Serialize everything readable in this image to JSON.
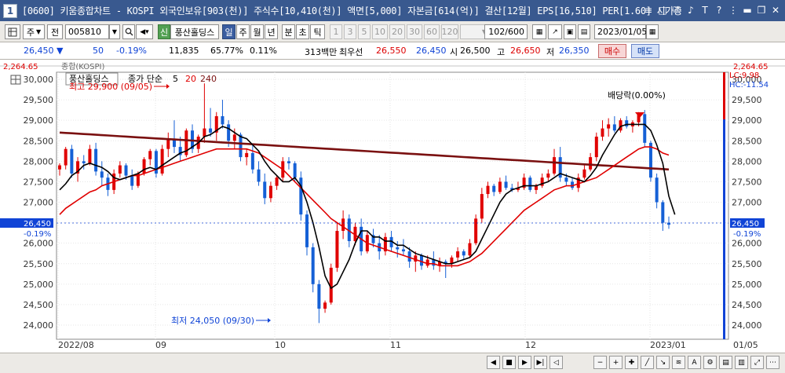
{
  "window": {
    "icon_label": "1",
    "title": "[0600] 키움종합차트 - KOSPI 외국인보유[903(천)] 주식수[10,410(천)] 액면[5,000] 자본금[614(억)] 결산[12월] EPS[16,510] PER[1.60] 시가총",
    "buttons": [
      "≡",
      "□",
      "⎚",
      "♪",
      "T",
      "?",
      "⋮",
      "▬",
      "❐",
      "✕"
    ]
  },
  "toolbar": {
    "chart_icon": "chart-grid-icon",
    "period_unit": "주",
    "prev_label": "전",
    "code_value": "005810",
    "buttons": [
      "신",
      "풍산홀딩스",
      "일",
      "주",
      "월",
      "년",
      "분",
      "초",
      "틱",
      "1",
      "3",
      "5",
      "10",
      "20",
      "30",
      "60",
      "120"
    ],
    "count_value": "102",
    "count_total": "/600",
    "date_value": "2023/01/05"
  },
  "quote": {
    "price": "26,450 ▼",
    "change": "50",
    "change_pct": "-0.19%",
    "volume": "11,835",
    "ratio": "65.77%",
    "turnover": "0.11%",
    "trade_value": "313백만",
    "ask_label": "최우선",
    "ask_price": "26,550",
    "bid_price": "26,450",
    "open_label": "시",
    "open": "26,500",
    "high_label": "고",
    "high": "26,650",
    "low_label": "저",
    "low": "26,350",
    "buy_label": "매수",
    "sell_label": "매도"
  },
  "chart_data": {
    "type": "candlestick",
    "stock_label": "풍산홀딩스",
    "legend_text": "종가 단순",
    "ma_periods": [
      "5",
      "20",
      "240"
    ],
    "ma_colors": [
      "#000000",
      "#e00000",
      "#7a1010"
    ],
    "top_overlay": "종합(KOSPI)",
    "top_overlay_right": "2,264.65",
    "top_left_value": "2,264.65",
    "ylim": [
      24000,
      30000
    ],
    "yticks": [
      "30,000",
      "29,500",
      "29,000",
      "28,500",
      "28,000",
      "27,500",
      "27,000",
      "26,500",
      "26,000",
      "25,500",
      "25,000",
      "24,500",
      "24,000"
    ],
    "left_yticks": [
      "30,000",
      "29,500",
      "29,000",
      "28,500",
      "28,000",
      "27,500",
      "27,000",
      "26,500",
      "26,000",
      "25,500",
      "25,000",
      "24,500",
      "24,000"
    ],
    "xlabels": [
      "2022/08",
      "09",
      "10",
      "11",
      "12",
      "2023/01",
      "01/05"
    ],
    "current_price": "26,450",
    "current_pct": "-0.19%",
    "lc_label": "LC:9.98",
    "hc_label": "HC:-11.54",
    "high_annotation": "최고 29,900 (09/05)",
    "low_annotation": "최저 24,050 (09/30)",
    "dividend_annotation": "배당락(0.00%)",
    "candles": [
      {
        "o": 27800,
        "h": 27950,
        "l": 27650,
        "c": 27900
      },
      {
        "o": 27900,
        "h": 28350,
        "l": 27800,
        "c": 28300
      },
      {
        "o": 28300,
        "h": 28400,
        "l": 27600,
        "c": 27700
      },
      {
        "o": 27700,
        "h": 28100,
        "l": 27500,
        "c": 28000
      },
      {
        "o": 28000,
        "h": 28150,
        "l": 27800,
        "c": 27950
      },
      {
        "o": 27950,
        "h": 28400,
        "l": 27900,
        "c": 28300
      },
      {
        "o": 28300,
        "h": 28450,
        "l": 27650,
        "c": 27750
      },
      {
        "o": 27750,
        "h": 28000,
        "l": 27400,
        "c": 27600
      },
      {
        "o": 27600,
        "h": 27700,
        "l": 27150,
        "c": 27300
      },
      {
        "o": 27300,
        "h": 27800,
        "l": 27200,
        "c": 27700
      },
      {
        "o": 27700,
        "h": 28000,
        "l": 27600,
        "c": 27900
      },
      {
        "o": 27900,
        "h": 27950,
        "l": 27550,
        "c": 27650
      },
      {
        "o": 27650,
        "h": 27800,
        "l": 27300,
        "c": 27400
      },
      {
        "o": 27400,
        "h": 27750,
        "l": 27350,
        "c": 27700
      },
      {
        "o": 27700,
        "h": 28100,
        "l": 27650,
        "c": 28050
      },
      {
        "o": 28050,
        "h": 28300,
        "l": 27900,
        "c": 28250
      },
      {
        "o": 28250,
        "h": 28300,
        "l": 27600,
        "c": 27700
      },
      {
        "o": 27700,
        "h": 28400,
        "l": 27650,
        "c": 28300
      },
      {
        "o": 28300,
        "h": 28700,
        "l": 28100,
        "c": 28550
      },
      {
        "o": 28550,
        "h": 29000,
        "l": 28200,
        "c": 28350
      },
      {
        "o": 28350,
        "h": 28600,
        "l": 28000,
        "c": 28150
      },
      {
        "o": 28150,
        "h": 28800,
        "l": 28100,
        "c": 28750
      },
      {
        "o": 28750,
        "h": 28900,
        "l": 28200,
        "c": 28300
      },
      {
        "o": 28300,
        "h": 28650,
        "l": 28200,
        "c": 28600
      },
      {
        "o": 28600,
        "h": 29900,
        "l": 28450,
        "c": 28800
      },
      {
        "o": 28800,
        "h": 29300,
        "l": 28600,
        "c": 28700
      },
      {
        "o": 28700,
        "h": 29200,
        "l": 28500,
        "c": 29100
      },
      {
        "o": 29100,
        "h": 29500,
        "l": 28800,
        "c": 28900
      },
      {
        "o": 28900,
        "h": 29000,
        "l": 28350,
        "c": 28500
      },
      {
        "o": 28500,
        "h": 28800,
        "l": 28300,
        "c": 28650
      },
      {
        "o": 28650,
        "h": 28700,
        "l": 28000,
        "c": 28100
      },
      {
        "o": 28100,
        "h": 28300,
        "l": 27900,
        "c": 28200
      },
      {
        "o": 28200,
        "h": 28400,
        "l": 27700,
        "c": 27800
      },
      {
        "o": 27800,
        "h": 28000,
        "l": 27400,
        "c": 27500
      },
      {
        "o": 27500,
        "h": 27700,
        "l": 26950,
        "c": 27100
      },
      {
        "o": 27100,
        "h": 27500,
        "l": 27000,
        "c": 27400
      },
      {
        "o": 27400,
        "h": 27650,
        "l": 27300,
        "c": 27600
      },
      {
        "o": 27600,
        "h": 28100,
        "l": 27500,
        "c": 28000
      },
      {
        "o": 28000,
        "h": 28100,
        "l": 27800,
        "c": 27950
      },
      {
        "o": 27950,
        "h": 28000,
        "l": 27500,
        "c": 27600
      },
      {
        "o": 27600,
        "h": 27750,
        "l": 26550,
        "c": 26700
      },
      {
        "o": 26700,
        "h": 26800,
        "l": 25700,
        "c": 25900
      },
      {
        "o": 25900,
        "h": 26000,
        "l": 24800,
        "c": 25000
      },
      {
        "o": 25000,
        "h": 25100,
        "l": 24050,
        "c": 24400
      },
      {
        "o": 24400,
        "h": 24600,
        "l": 24300,
        "c": 24550
      },
      {
        "o": 24550,
        "h": 25500,
        "l": 24500,
        "c": 25400
      },
      {
        "o": 25400,
        "h": 26500,
        "l": 25300,
        "c": 26300
      },
      {
        "o": 26300,
        "h": 26800,
        "l": 26100,
        "c": 26600
      },
      {
        "o": 26600,
        "h": 26700,
        "l": 25900,
        "c": 26050
      },
      {
        "o": 26050,
        "h": 26500,
        "l": 25950,
        "c": 26400
      },
      {
        "o": 26400,
        "h": 26600,
        "l": 25700,
        "c": 25800
      },
      {
        "o": 25800,
        "h": 26300,
        "l": 25750,
        "c": 26200
      },
      {
        "o": 26200,
        "h": 26350,
        "l": 25900,
        "c": 26000
      },
      {
        "o": 26000,
        "h": 26200,
        "l": 25600,
        "c": 25800
      },
      {
        "o": 25800,
        "h": 26250,
        "l": 25700,
        "c": 26150
      },
      {
        "o": 26150,
        "h": 26300,
        "l": 25800,
        "c": 25900
      },
      {
        "o": 25900,
        "h": 26050,
        "l": 25650,
        "c": 25850
      },
      {
        "o": 25850,
        "h": 26100,
        "l": 25700,
        "c": 25800
      },
      {
        "o": 25800,
        "h": 25900,
        "l": 25400,
        "c": 25550
      },
      {
        "o": 25550,
        "h": 25800,
        "l": 25300,
        "c": 25700
      },
      {
        "o": 25700,
        "h": 25750,
        "l": 25350,
        "c": 25450
      },
      {
        "o": 25450,
        "h": 25700,
        "l": 25400,
        "c": 25600
      },
      {
        "o": 25600,
        "h": 25800,
        "l": 25350,
        "c": 25450
      },
      {
        "o": 25450,
        "h": 25650,
        "l": 25300,
        "c": 25550
      },
      {
        "o": 25550,
        "h": 25600,
        "l": 25150,
        "c": 25500
      },
      {
        "o": 25500,
        "h": 25700,
        "l": 25400,
        "c": 25650
      },
      {
        "o": 25650,
        "h": 25900,
        "l": 25550,
        "c": 25800
      },
      {
        "o": 25800,
        "h": 25850,
        "l": 25600,
        "c": 25700
      },
      {
        "o": 25700,
        "h": 26100,
        "l": 25650,
        "c": 26000
      },
      {
        "o": 26000,
        "h": 26700,
        "l": 25950,
        "c": 26600
      },
      {
        "o": 26600,
        "h": 27350,
        "l": 26500,
        "c": 27200
      },
      {
        "o": 27200,
        "h": 27500,
        "l": 27100,
        "c": 27400
      },
      {
        "o": 27400,
        "h": 27450,
        "l": 27150,
        "c": 27250
      },
      {
        "o": 27250,
        "h": 27600,
        "l": 27200,
        "c": 27500
      },
      {
        "o": 27500,
        "h": 27650,
        "l": 27300,
        "c": 27350
      },
      {
        "o": 27350,
        "h": 27450,
        "l": 27250,
        "c": 27300
      },
      {
        "o": 27300,
        "h": 27500,
        "l": 27250,
        "c": 27350
      },
      {
        "o": 27350,
        "h": 27700,
        "l": 27300,
        "c": 27600
      },
      {
        "o": 27600,
        "h": 27650,
        "l": 27250,
        "c": 27300
      },
      {
        "o": 27300,
        "h": 27450,
        "l": 27200,
        "c": 27400
      },
      {
        "o": 27400,
        "h": 27700,
        "l": 27350,
        "c": 27600
      },
      {
        "o": 27600,
        "h": 27800,
        "l": 27500,
        "c": 27700
      },
      {
        "o": 27700,
        "h": 28300,
        "l": 27650,
        "c": 28100
      },
      {
        "o": 28100,
        "h": 28350,
        "l": 27500,
        "c": 27600
      },
      {
        "o": 27600,
        "h": 27700,
        "l": 27400,
        "c": 27500
      },
      {
        "o": 27500,
        "h": 27600,
        "l": 27300,
        "c": 27350
      },
      {
        "o": 27350,
        "h": 27700,
        "l": 27250,
        "c": 27600
      },
      {
        "o": 27600,
        "h": 27900,
        "l": 27550,
        "c": 27800
      },
      {
        "o": 27800,
        "h": 28200,
        "l": 27750,
        "c": 28100
      },
      {
        "o": 28100,
        "h": 28700,
        "l": 28000,
        "c": 28600
      },
      {
        "o": 28600,
        "h": 29000,
        "l": 28500,
        "c": 28800
      },
      {
        "o": 28800,
        "h": 29050,
        "l": 28600,
        "c": 28900
      },
      {
        "o": 28900,
        "h": 29100,
        "l": 28700,
        "c": 28750
      },
      {
        "o": 28750,
        "h": 29050,
        "l": 28700,
        "c": 29000
      },
      {
        "o": 29000,
        "h": 29100,
        "l": 28800,
        "c": 28850
      },
      {
        "o": 28850,
        "h": 29000,
        "l": 28700,
        "c": 28950
      },
      {
        "o": 28950,
        "h": 29200,
        "l": 28850,
        "c": 29150
      },
      {
        "o": 29150,
        "h": 29250,
        "l": 28350,
        "c": 28450
      },
      {
        "o": 28450,
        "h": 28500,
        "l": 27500,
        "c": 27600
      },
      {
        "o": 27600,
        "h": 27700,
        "l": 26850,
        "c": 27000
      },
      {
        "o": 27000,
        "h": 27050,
        "l": 26300,
        "c": 26500
      },
      {
        "o": 26500,
        "h": 26650,
        "l": 26350,
        "c": 26450
      }
    ],
    "ma5": [
      27300,
      27450,
      27650,
      27750,
      27900,
      27950,
      27900,
      27850,
      27750,
      27600,
      27550,
      27600,
      27650,
      27700,
      27800,
      27850,
      27800,
      27900,
      28000,
      28100,
      28200,
      28250,
      28350,
      28450,
      28600,
      28650,
      28750,
      28850,
      28800,
      28700,
      28600,
      28550,
      28400,
      28250,
      28000,
      27800,
      27650,
      27500,
      27500,
      27600,
      27400,
      27000,
      26500,
      25900,
      25200,
      24900,
      25000,
      25300,
      25600,
      26000,
      26300,
      26300,
      26150,
      26150,
      26050,
      26050,
      25950,
      25950,
      25850,
      25750,
      25700,
      25650,
      25600,
      25550,
      25500,
      25500,
      25550,
      25600,
      25650,
      25800,
      26100,
      26400,
      26700,
      27000,
      27200,
      27300,
      27350,
      27400,
      27400,
      27400,
      27450,
      27500,
      27600,
      27700,
      27650,
      27600,
      27550,
      27500,
      27650,
      27850,
      28150,
      28400,
      28650,
      28850,
      28900,
      28900,
      28900,
      28900,
      28750,
      28400,
      27950,
      27150,
      26700
    ],
    "ma20": [
      26700,
      26850,
      26950,
      27050,
      27150,
      27250,
      27300,
      27400,
      27450,
      27500,
      27550,
      27600,
      27650,
      27650,
      27700,
      27750,
      27800,
      27850,
      27900,
      27950,
      28000,
      28050,
      28100,
      28150,
      28200,
      28250,
      28300,
      28300,
      28300,
      28300,
      28300,
      28300,
      28250,
      28200,
      28100,
      28000,
      27900,
      27800,
      27650,
      27500,
      27350,
      27200,
      27050,
      26900,
      26750,
      26600,
      26500,
      26400,
      26300,
      26200,
      26100,
      26000,
      25950,
      25900,
      25850,
      25800,
      25750,
      25700,
      25650,
      25600,
      25550,
      25500,
      25500,
      25450,
      25450,
      25450,
      25450,
      25500,
      25550,
      25650,
      25750,
      25900,
      26050,
      26200,
      26350,
      26500,
      26650,
      26800,
      26900,
      27000,
      27100,
      27200,
      27300,
      27350,
      27400,
      27400,
      27450,
      27500,
      27550,
      27600,
      27700,
      27800,
      27900,
      28000,
      28100,
      28200,
      28300,
      28350,
      28350,
      28300,
      28200,
      28150
    ]
  }
}
